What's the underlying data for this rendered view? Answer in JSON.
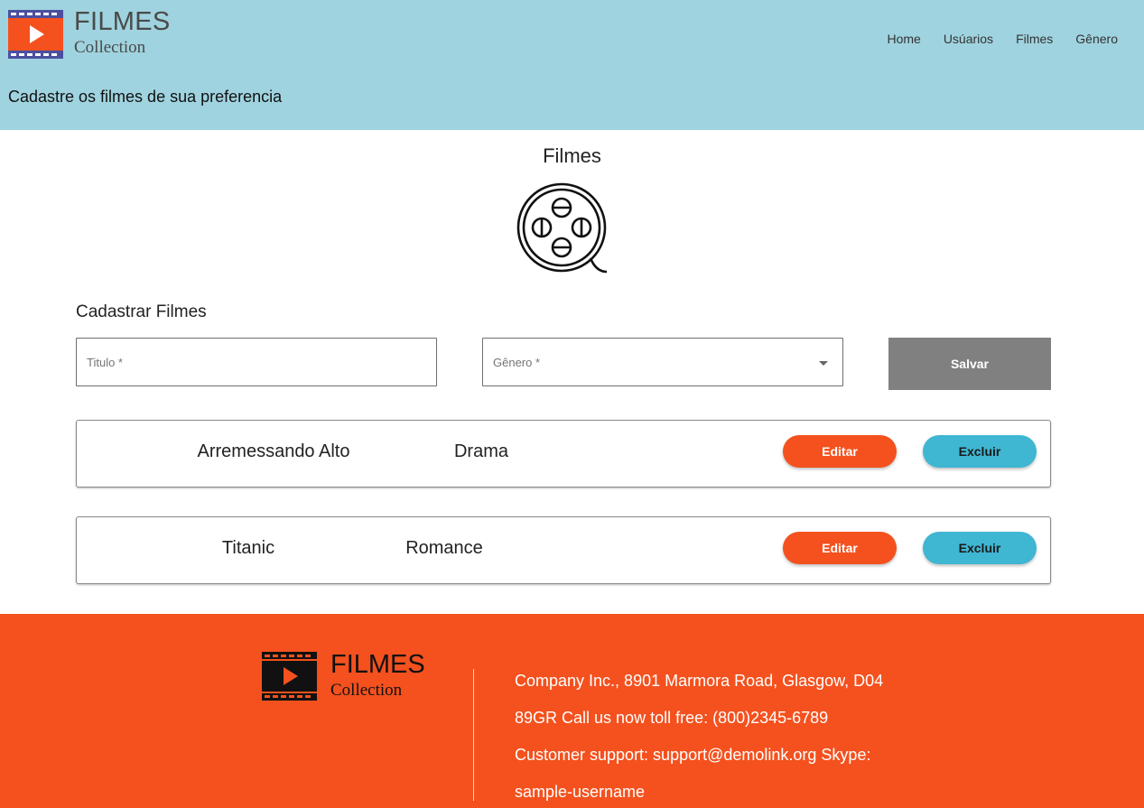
{
  "header": {
    "brand_title": "FILMES",
    "brand_subtitle": "Collection",
    "tagline": "Cadastre os filmes de sua preferencia",
    "nav": [
      "Home",
      "Usúarios",
      "Filmes",
      "Gênero"
    ],
    "logo_icon": "film-play-icon",
    "background": "#9fd3df"
  },
  "main": {
    "page_title": "Filmes",
    "reel_icon": "film-reel-icon",
    "section_title": "Cadastrar Filmes",
    "form": {
      "titulo_placeholder": "Titulo *",
      "titulo_value": "",
      "genero_placeholder": "Gênero *",
      "genero_value": "",
      "save_label": "Salvar"
    },
    "movies": [
      {
        "title": "Arremessando Alto",
        "genre": "Drama",
        "edit_label": "Editar",
        "delete_label": "Excluir"
      },
      {
        "title": "Titanic",
        "genre": "Romance",
        "edit_label": "Editar",
        "delete_label": "Excluir"
      }
    ]
  },
  "footer": {
    "brand_title": "FILMES",
    "brand_subtitle": "Collection",
    "info_lines": [
      "Company Inc., 8901 Marmora Road, Glasgow, D04",
      "89GR Call us now toll free: (800)2345-6789",
      "Customer support: support@demolink.org Skype:",
      "sample-username"
    ],
    "background": "#f4511e"
  },
  "colors": {
    "accent_orange": "#f4511e",
    "accent_blue": "#3fb6d2",
    "save_gray": "#808080",
    "logo_purple": "#4a4fa0"
  }
}
